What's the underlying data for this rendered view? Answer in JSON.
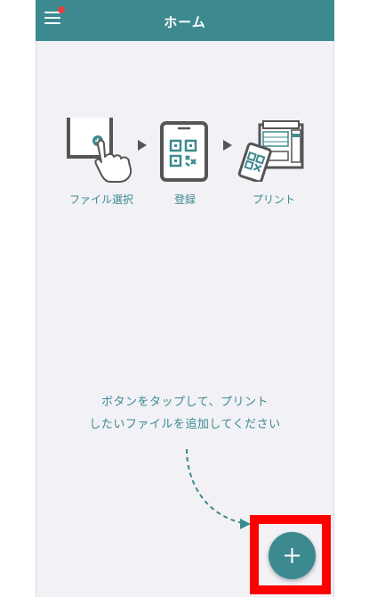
{
  "header": {
    "title": "ホーム",
    "menu_icon": "hamburger-menu-icon",
    "notification_color": "#e0413d"
  },
  "steps": [
    {
      "label": "ファイル選択",
      "icon": "tap-file-icon"
    },
    {
      "label": "登録",
      "icon": "qr-code-phone-icon"
    },
    {
      "label": "プリント",
      "icon": "printer-icon"
    }
  ],
  "instruction": {
    "line1": "ボタンをタップして、プリント",
    "line2": "したいファイルを追加してください"
  },
  "fab": {
    "icon": "plus-icon"
  },
  "colors": {
    "accent": "#3c8a8f",
    "background": "#f1f1f6",
    "highlight": "#ff0000"
  }
}
